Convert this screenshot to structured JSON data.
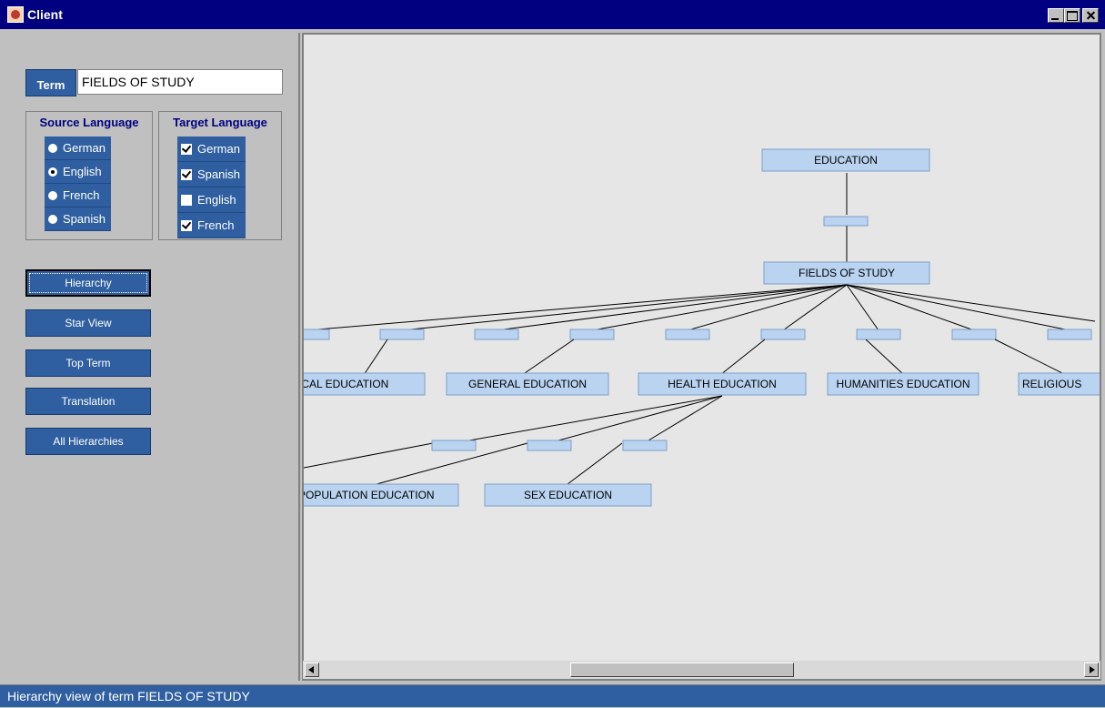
{
  "window": {
    "title": "Client"
  },
  "term": {
    "label": "Term",
    "value": "FIELDS OF STUDY"
  },
  "source_language": {
    "title": "Source Language",
    "options": [
      {
        "label": "German",
        "selected": false
      },
      {
        "label": "English",
        "selected": true
      },
      {
        "label": "French",
        "selected": false
      },
      {
        "label": "Spanish",
        "selected": false
      }
    ]
  },
  "target_language": {
    "title": "Target Language",
    "options": [
      {
        "label": "German",
        "checked": true
      },
      {
        "label": "Spanish",
        "checked": true
      },
      {
        "label": "English",
        "checked": false
      },
      {
        "label": "French",
        "checked": true
      }
    ]
  },
  "nav_buttons": [
    {
      "label": "Hierarchy",
      "active": true
    },
    {
      "label": "Star View",
      "active": false
    },
    {
      "label": "Top Term",
      "active": false
    },
    {
      "label": "Translation",
      "active": false
    },
    {
      "label": "All Hierarchies",
      "active": false
    }
  ],
  "hierarchy": {
    "root": "EDUCATION",
    "focus": "FIELDS OF STUDY",
    "children": [
      "ICAL EDUCATION",
      "GENERAL EDUCATION",
      "HEALTH EDUCATION",
      "HUMANITIES EDUCATION",
      "RELIGIOUS"
    ],
    "grandchildren": [
      "POPULATION EDUCATION",
      "SEX EDUCATION"
    ]
  },
  "status": {
    "text": "Hierarchy view of term  FIELDS OF STUDY"
  },
  "colors": {
    "node_fill": "#b9d3f0",
    "panel_blue": "#2f5fa0",
    "titlebar": "#000080",
    "canvas_bg": "#e6e6e6"
  }
}
